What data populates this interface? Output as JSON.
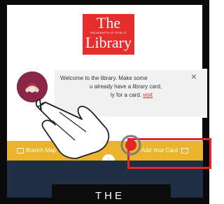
{
  "logo": {
    "line1": "The",
    "line2": "INDIANAPOLIS PUBLIC",
    "line3": "Library",
    "brand_color": "#e42f2c"
  },
  "welcome": {
    "line1": "Welcome to the library. Make some",
    "line2": "u already have a library card,",
    "line3": "ly for a card.",
    "link": "visit",
    "close_icon": "×"
  },
  "toolbar": {
    "branch_label": "Branch Map",
    "add_card_label": "Add Your Card",
    "plus_label": "+",
    "bar_color": "#ecb32d"
  },
  "content": {
    "book_title": "THE"
  },
  "highlight_color": "#e3262b"
}
